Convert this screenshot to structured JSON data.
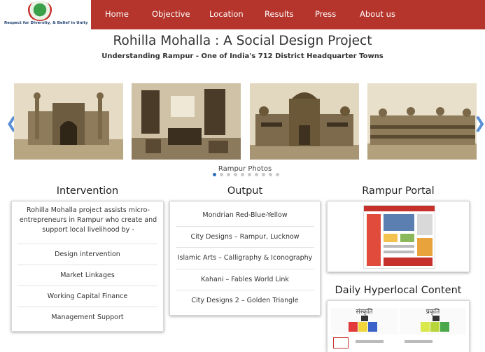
{
  "logo": {
    "tagline": "Respect for Diversity, & Belief in Unity"
  },
  "nav": {
    "items": [
      "Home",
      "Objective",
      "Location",
      "Results",
      "Press",
      "About us"
    ],
    "background": "#b5342b"
  },
  "header": {
    "title": "Rohilla Mohalla : A Social Design Project",
    "subtitle": "Understanding Rampur - One of India's 712 District Headquarter Towns"
  },
  "carousel": {
    "caption": "Rampur Photos",
    "photos": [
      "gate-photo",
      "interior-photo",
      "palace-photo",
      "building-photo"
    ],
    "dot_count": 10,
    "active_dot": 1
  },
  "intervention": {
    "title": "Intervention",
    "intro": "Rohilla Mohalla project assists micro-entrepreneurs in Rampur who create and support local livelihood by -",
    "items": [
      "Design intervention",
      "Market Linkages",
      "Working Capital Finance",
      "Management Support"
    ]
  },
  "output": {
    "title": "Output",
    "items": [
      "Mondrian Red-Blue-Yellow",
      "City Designs – Rampur, Lucknow",
      "Islamic Arts – Calligraphy & Iconography",
      "Kahani – Fables World Link",
      "City Designs 2 – Golden Triangle"
    ]
  },
  "portal": {
    "title": "Rampur Portal"
  },
  "daily": {
    "title": "Daily Hyperlocal Content",
    "thumbs": [
      "संस्कृति",
      "प्रकृति"
    ]
  }
}
